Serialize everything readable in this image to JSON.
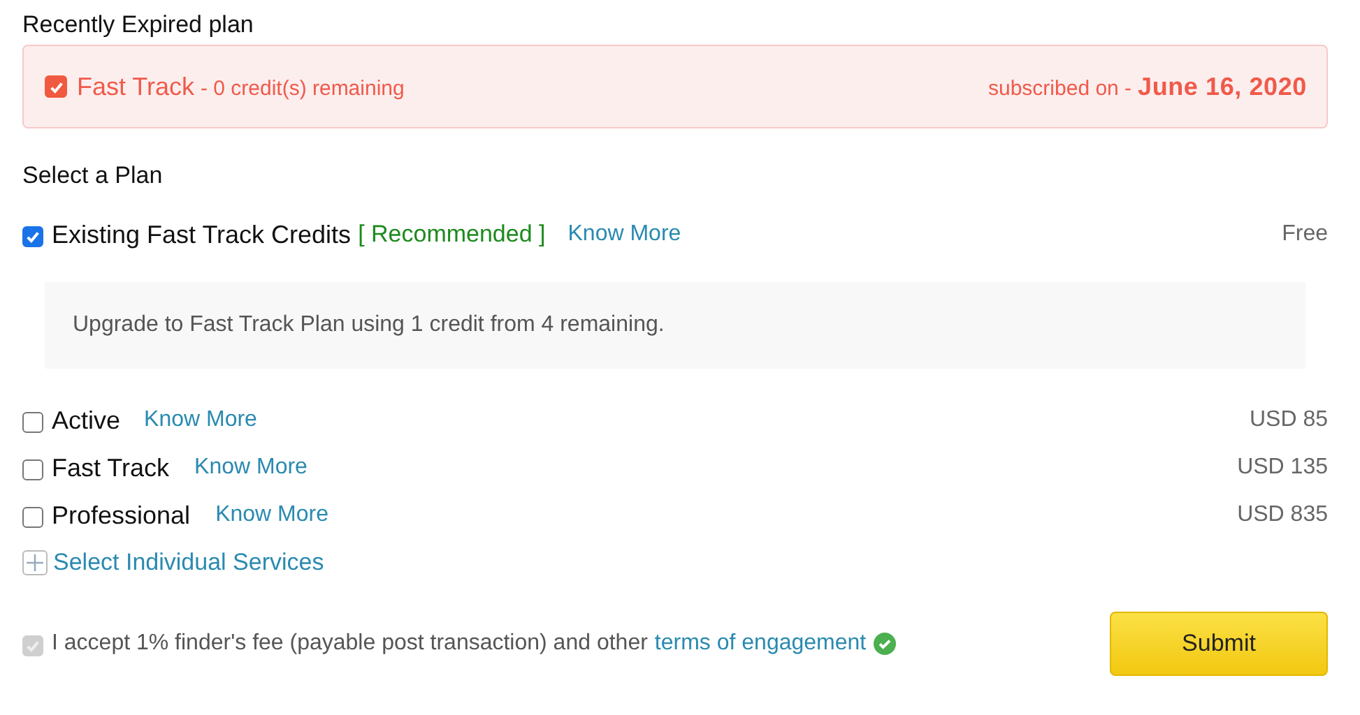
{
  "expired_section": {
    "heading": "Recently Expired plan",
    "plan": {
      "checked": true,
      "name": "Fast Track",
      "credits": "- 0 credit(s) remaining",
      "subscribed_label": "subscribed on -",
      "date": "June 16, 2020"
    }
  },
  "select_section": {
    "heading": "Select a Plan",
    "plans": [
      {
        "name": "Existing Fast Track Credits",
        "checked": true,
        "tag": "[ Recommended ]",
        "link": "Know More",
        "price": "Free",
        "note": "Upgrade to Fast Track Plan using 1 credit from 4 remaining."
      },
      {
        "name": "Active",
        "checked": false,
        "link": "Know More",
        "price": "USD 85"
      },
      {
        "name": "Fast Track",
        "checked": false,
        "link": "Know More",
        "price": "USD 135"
      },
      {
        "name": "Professional",
        "checked": false,
        "link": "Know More",
        "price": "USD 835"
      }
    ],
    "individual_services": "Select Individual Services"
  },
  "footer": {
    "accept": {
      "checked": true,
      "disabled": true,
      "text": "I accept 1% finder's fee (payable post transaction) and other",
      "link": "terms of engagement",
      "verified": true
    },
    "submit": "Submit"
  }
}
